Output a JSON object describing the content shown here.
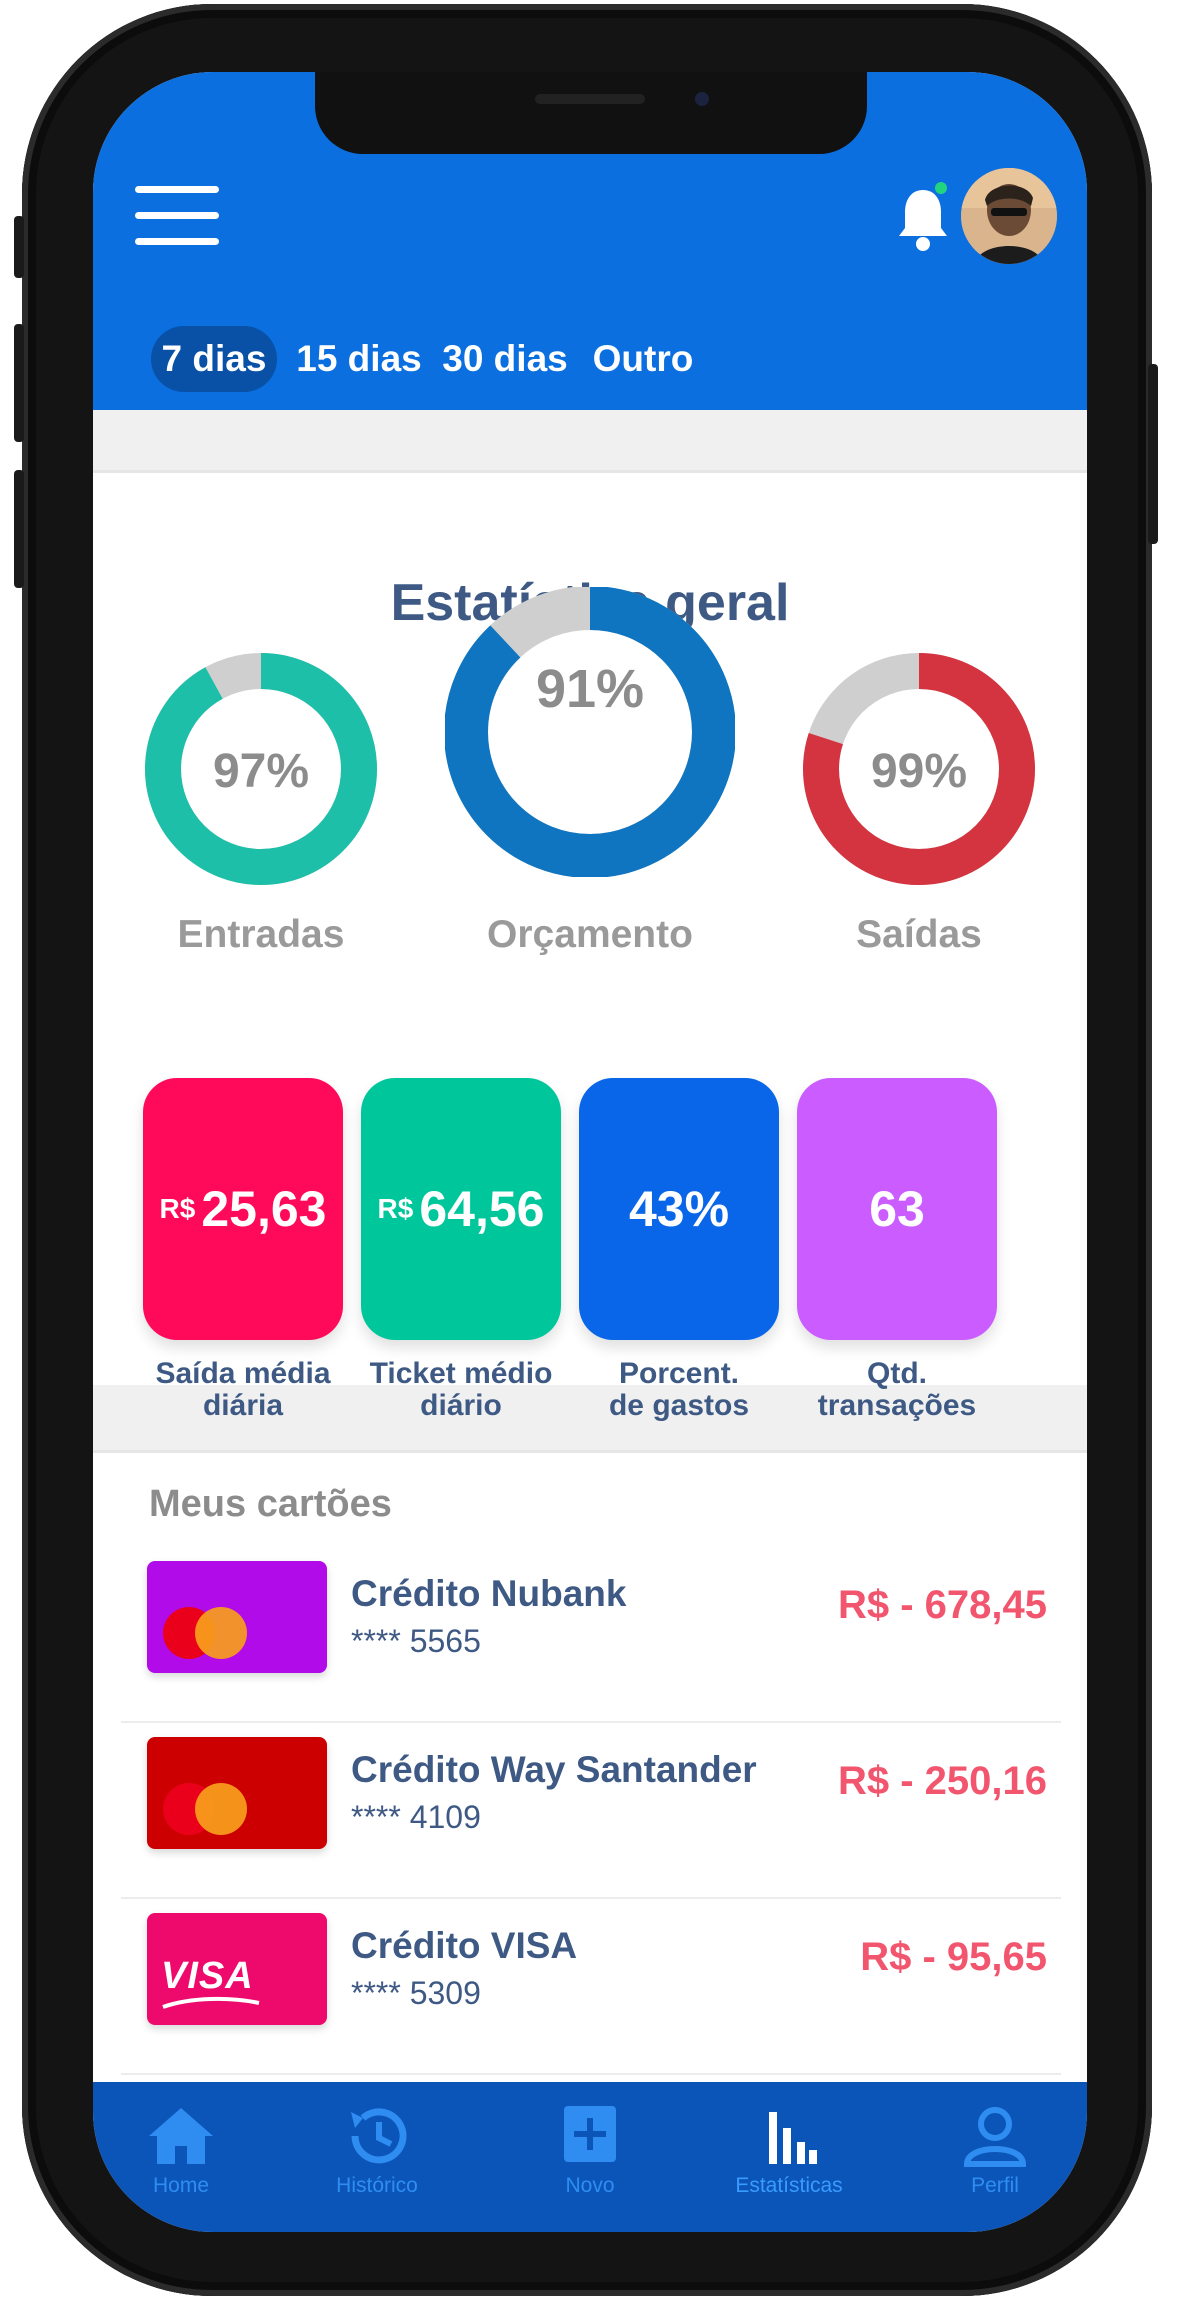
{
  "header": {
    "menu_icon": "hamburger-menu-icon",
    "notification_icon": "bell-icon",
    "avatar": "user-avatar",
    "colors": {
      "header_bg": "#0b6fe0",
      "active_tab_bg": "#0851a6"
    }
  },
  "tabs": [
    {
      "label": "7 dias",
      "active": true
    },
    {
      "label": "15 dias",
      "active": false
    },
    {
      "label": "30 dias",
      "active": false
    },
    {
      "label": "Outro",
      "active": false
    }
  ],
  "stats": {
    "title": "Estatística geral",
    "gauges": [
      {
        "label": "Entradas",
        "value_text": "97%",
        "fill_fraction": 0.92,
        "color": "#1dbfa8"
      },
      {
        "label": "Orçamento",
        "value_text": "91%",
        "fill_fraction": 0.88,
        "color": "#0f75c0"
      },
      {
        "label": "Saídas",
        "value_text": "99%",
        "fill_fraction": 0.8,
        "color": "#d4343f"
      }
    ],
    "tiles": [
      {
        "currency": "R$",
        "value": "25,63",
        "caption_line1": "Saída média",
        "caption_line2": "diária",
        "color": "#ff0a5a"
      },
      {
        "currency": "R$",
        "value": "64,56",
        "caption_line1": "Ticket médio",
        "caption_line2": "diário",
        "color": "#00c79b"
      },
      {
        "currency": "",
        "value": "43%",
        "caption_line1": "Porcent.",
        "caption_line2": "de gastos",
        "color": "#0a66e8"
      },
      {
        "currency": "",
        "value": "63",
        "caption_line1": "Qtd.",
        "caption_line2": "transações",
        "color": "#cb5cff"
      }
    ]
  },
  "cards": {
    "title": "Meus cartões",
    "items": [
      {
        "name": "Crédito Nubank",
        "number": "**** 5565",
        "amount": "R$ - 678,45",
        "brand": "mastercard",
        "color": "#b00be8"
      },
      {
        "name": "Crédito Way Santander",
        "number": "**** 4109",
        "amount": "R$ - 250,16",
        "brand": "mastercard",
        "color": "#cc0000"
      },
      {
        "name": "Crédito VISA",
        "number": "**** 5309",
        "amount": "R$ - 95,65",
        "brand": "VISA",
        "color": "#ee0a6c"
      }
    ]
  },
  "nav": [
    {
      "label": "Home",
      "icon": "home-icon"
    },
    {
      "label": "Histórico",
      "icon": "history-icon"
    },
    {
      "label": "Novo",
      "icon": "plus-icon"
    },
    {
      "label": "Estatísticas",
      "icon": "bar-chart-icon",
      "active": true
    },
    {
      "label": "Perfil",
      "icon": "user-icon"
    }
  ]
}
